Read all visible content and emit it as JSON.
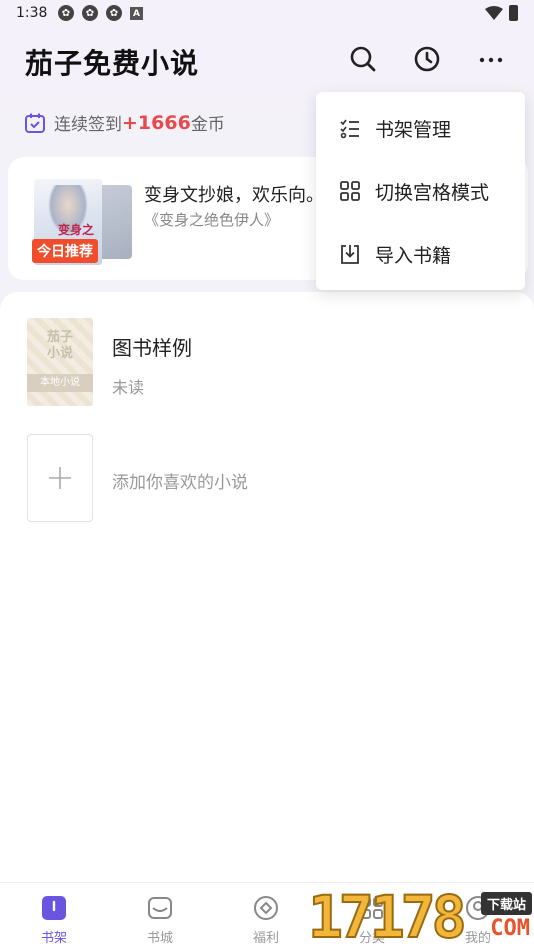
{
  "status_bar": {
    "time": "1:38",
    "notif_badge": "A"
  },
  "header": {
    "title": "茄子免费小说"
  },
  "checkin": {
    "prefix": "连续签到",
    "coins": "+1666",
    "suffix": "金币"
  },
  "recommend": {
    "badge": "今日推荐",
    "cover_text": "变身之",
    "title": "变身文抄娘，欢乐向。",
    "subtitle": "《变身之绝色伊人》"
  },
  "shelf": {
    "book": {
      "cover_title": "茄子\n小说",
      "cover_band": "本地小说",
      "name": "图书样例",
      "status": "未读"
    },
    "add_label": "添加你喜欢的小说"
  },
  "menu": {
    "items": [
      {
        "label": "书架管理",
        "icon": "list-check-icon"
      },
      {
        "label": "切换宫格模式",
        "icon": "grid-icon"
      },
      {
        "label": "导入书籍",
        "icon": "import-icon"
      }
    ]
  },
  "tabs": [
    {
      "label": "书架",
      "icon": "bookshelf-icon",
      "active": true
    },
    {
      "label": "书城",
      "icon": "bookstore-icon",
      "active": false
    },
    {
      "label": "福利",
      "icon": "welfare-icon",
      "active": false
    },
    {
      "label": "分类",
      "icon": "category-icon",
      "active": false
    },
    {
      "label": "我的",
      "icon": "profile-icon",
      "active": false
    }
  ],
  "watermark": {
    "number": "17178",
    "tag": "下载站",
    "domain": "COM"
  },
  "colors": {
    "accent": "#6a55e0",
    "coin": "#e74a4a",
    "badge": "#ef4d2b"
  }
}
